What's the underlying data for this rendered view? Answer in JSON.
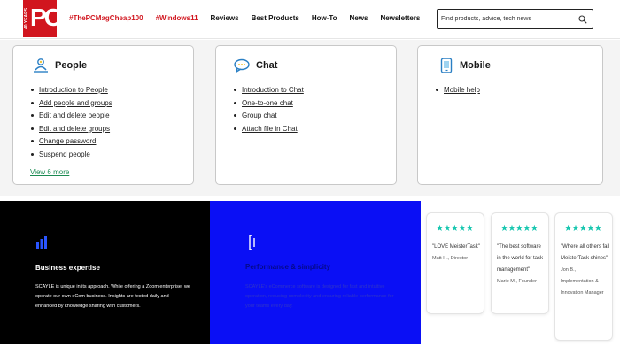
{
  "header": {
    "logo_years": "40 YEARS",
    "logo_text": "PC",
    "nav": [
      "#ThePCMagCheap100",
      "#Windows11",
      "Reviews",
      "Best Products",
      "How-To",
      "News",
      "Newsletters"
    ],
    "search_placeholder": "Find products, advice, tech news"
  },
  "cards": {
    "people": {
      "title": "People",
      "icon": "people-icon",
      "items": [
        "Introduction to People",
        "Add people and groups",
        "Edit and delete people",
        "Edit and delete groups",
        "Change password",
        "Suspend people"
      ],
      "view_more": "View 6 more"
    },
    "chat": {
      "title": "Chat",
      "icon": "chat-icon",
      "items": [
        "Introduction to Chat",
        "One-to-one chat",
        "Group chat",
        "Attach file in Chat"
      ]
    },
    "mobile": {
      "title": "Mobile",
      "icon": "mobile-icon",
      "items": [
        "Mobile help"
      ]
    }
  },
  "panels": {
    "business": {
      "icon": "bar-chart-icon",
      "title": "Business expertise",
      "body": "SCAYLE is unique in its approach. While offering a Zoom enterprise, we operate our own eCom business. Insights are tested daily and enhanced by knowledge sharing with customers."
    },
    "performance": {
      "icon": "bracket-icon",
      "title": "Performance & simplicity",
      "body": "SCAYLE's eCommerce software is designed for fast and intuitive operation, reducing complexity and ensuring reliable performance for your teams every day."
    }
  },
  "reviews": [
    {
      "stars": 5,
      "quote": "\"LOVE MeisterTask\"",
      "author": "Matt H., Director"
    },
    {
      "stars": 5,
      "quote": "\"The best software in the world for task management\"",
      "author": "Marie M., Founder"
    },
    {
      "stars": 5,
      "quote": "\"Where all others fail MeisterTask shines\"",
      "author": "Jon B., Implementation & Innovation Manager"
    }
  ],
  "colors": {
    "brand_red": "#d1151e",
    "link_green": "#1b8a52",
    "panel_black": "#000000",
    "panel_blue": "#0a0ff5",
    "star_teal": "#19c7b0"
  }
}
